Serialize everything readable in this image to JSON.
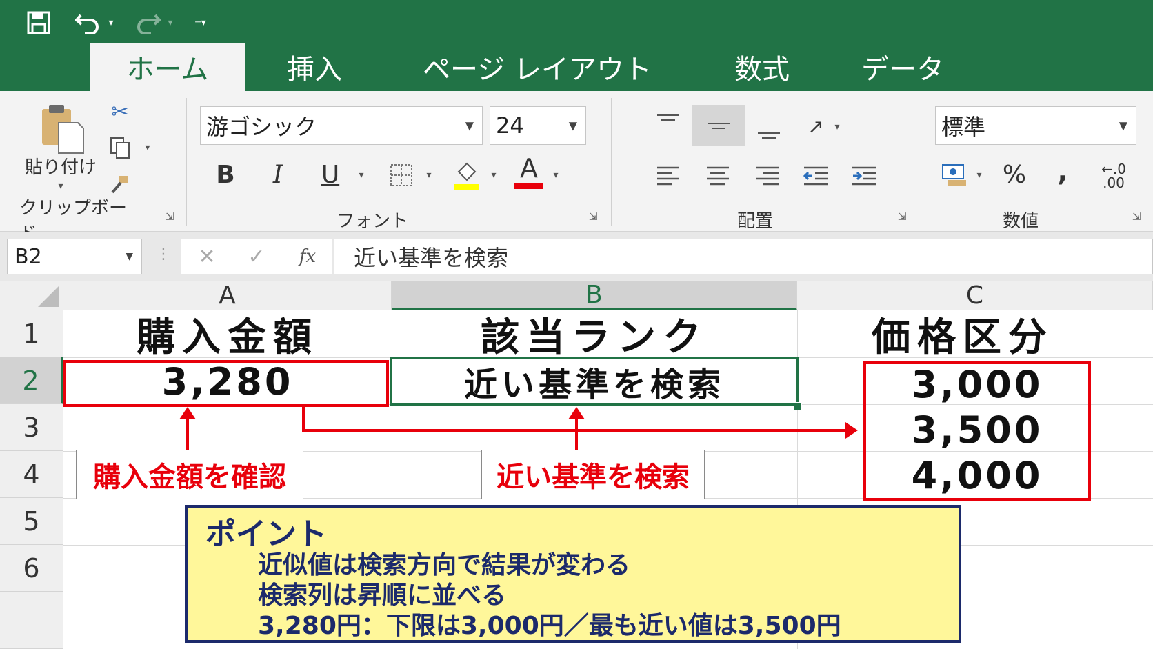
{
  "colors": {
    "excel_green": "#217346",
    "highlight_red": "#e8000b",
    "note_bg": "#fff79a",
    "note_text": "#1c2a6b"
  },
  "quick_access": {
    "icons": [
      "save-icon",
      "undo-icon",
      "redo-icon",
      "customize-icon"
    ]
  },
  "tabs": [
    {
      "label": "ホーム",
      "active": true
    },
    {
      "label": "挿入"
    },
    {
      "label": "ページ レイアウト"
    },
    {
      "label": "数式"
    },
    {
      "label": "データ"
    }
  ],
  "ribbon": {
    "clipboard": {
      "paste_label": "貼り付け",
      "group_label": "クリップボード"
    },
    "font": {
      "font_name": "游ゴシック",
      "font_size": "24",
      "bold": "B",
      "italic": "I",
      "underline": "U",
      "font_color_glyph": "A",
      "group_label": "フォント"
    },
    "alignment": {
      "group_label": "配置"
    },
    "number": {
      "format": "標準",
      "percent": "%",
      "comma": ",",
      "decimal": "←.0\n.00",
      "group_label": "数値"
    }
  },
  "formula_bar": {
    "name_box": "B2",
    "fx": "fx",
    "formula": "近い基準を検索"
  },
  "sheet": {
    "columns": [
      "A",
      "B",
      "C"
    ],
    "rows": [
      "1",
      "2",
      "3",
      "4",
      "5",
      "6"
    ],
    "selected_column": "B",
    "selected_row": "2",
    "A1": "購入金額",
    "B1": "該当ランク",
    "C1": "価格区分",
    "A2": "3,280",
    "B2": "近い基準を検索",
    "C2": "3,000",
    "C3": "3,500",
    "C4": "4,000"
  },
  "annotations": {
    "callout_a": "購入金額を確認",
    "callout_b": "近い基準を検索"
  },
  "point_box": {
    "title": "ポイント",
    "lines": [
      "近似値は検索方向で結果が変わる",
      "検索列は昇順に並べる",
      "3,280円：下限は3,000円／最も近い値は3,500円"
    ]
  }
}
